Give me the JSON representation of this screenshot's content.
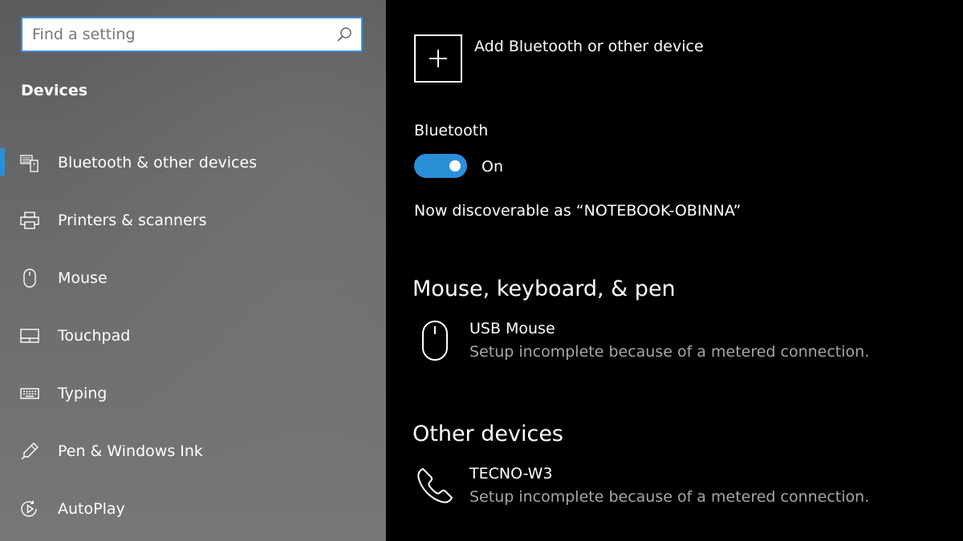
{
  "search": {
    "placeholder": "Find a setting"
  },
  "sidebar": {
    "title": "Devices",
    "items": [
      {
        "label": "Bluetooth & other devices",
        "icon": "bluetooth-devices-icon",
        "selected": true
      },
      {
        "label": "Printers & scanners",
        "icon": "printer-icon",
        "selected": false
      },
      {
        "label": "Mouse",
        "icon": "mouse-icon",
        "selected": false
      },
      {
        "label": "Touchpad",
        "icon": "touchpad-icon",
        "selected": false
      },
      {
        "label": "Typing",
        "icon": "keyboard-icon",
        "selected": false
      },
      {
        "label": "Pen & Windows Ink",
        "icon": "pen-icon",
        "selected": false
      },
      {
        "label": "AutoPlay",
        "icon": "autoplay-icon",
        "selected": false
      }
    ]
  },
  "main": {
    "add_device_label": "Add Bluetooth or other device",
    "bluetooth_label": "Bluetooth",
    "bluetooth_state": "On",
    "discoverable_text": "Now discoverable as “NOTEBOOK-OBINNA”",
    "groups": [
      {
        "title": "Mouse, keyboard, & pen",
        "devices": [
          {
            "name": "USB Mouse",
            "status": "Setup incomplete because of a metered connection.",
            "icon": "mouse-icon"
          }
        ]
      },
      {
        "title": "Other devices",
        "devices": [
          {
            "name": "TECNO-W3",
            "status": "Setup incomplete because of a metered connection.",
            "icon": "phone-icon"
          }
        ]
      }
    ]
  },
  "colors": {
    "accent": "#2b8fd8",
    "main_bg": "#000000",
    "secondary_text": "#a6a6a6"
  }
}
